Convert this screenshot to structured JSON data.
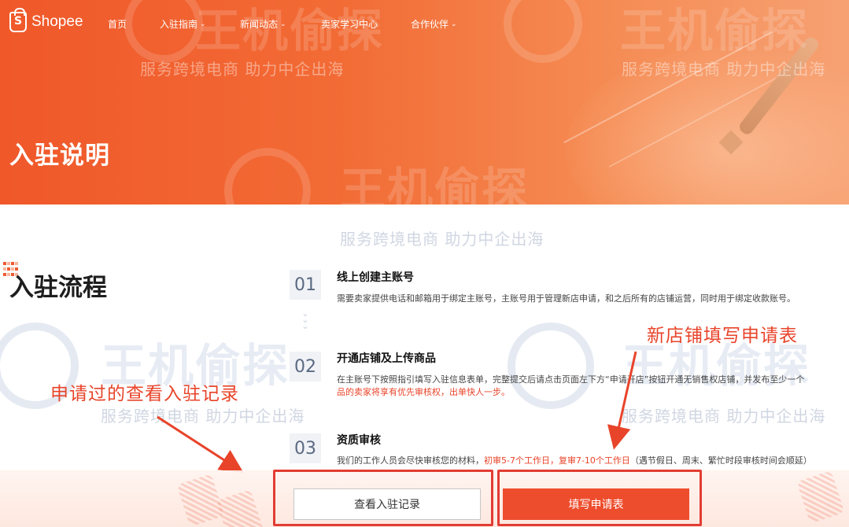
{
  "nav": {
    "logo_text": "Shopee",
    "logo_glyph": "S",
    "items": [
      {
        "label": "首页"
      },
      {
        "label": "入驻指南",
        "has_dropdown": true
      },
      {
        "label": "新闻动态",
        "has_dropdown": true
      },
      {
        "label": "卖家学习中心"
      },
      {
        "label": "合作伙伴",
        "has_dropdown": true
      }
    ],
    "chevron": "⌄"
  },
  "hero": {
    "title": "入驻说明"
  },
  "watermark": {
    "main": "王机偷探",
    "sub": "服务跨境电商  助力中企出海"
  },
  "process": {
    "title": "入驻流程",
    "steps": [
      {
        "num": "01",
        "title": "线上创建主账号",
        "desc": "需要卖家提供电话和邮箱用于绑定主账号，主账号用于管理新店申请，和之后所有的店铺运营，同时用于绑定收款账号。"
      },
      {
        "num": "02",
        "title": "开通店铺及上传商品",
        "desc_line1": "在主账号下按照指引填写入驻信息表单，完整提交后请点击页面左下方“申请开店”按钮开通无销售权店铺，并发布至少一个",
        "desc_line2": "品的卖家将享有优先审核权，出单快人一步。"
      },
      {
        "num": "03",
        "title": "资质审核",
        "desc_pre": "我们的工作人员会尽快审核您的材料，",
        "desc_red": "初审5-7个工作日，复审7-10个工作日",
        "desc_post": "（遇节假日、周末、繁忙时段审核时间会顺延）"
      }
    ]
  },
  "annotations": {
    "left": "申请过的查看入驻记录",
    "right": "新店铺填写申请表",
    "color": "#e8442a"
  },
  "actions": {
    "view_records": "查看入驻记录",
    "fill_application": "填写申请表"
  },
  "colors": {
    "brand": "#ee4d2d",
    "highlight": "#e23c33"
  }
}
